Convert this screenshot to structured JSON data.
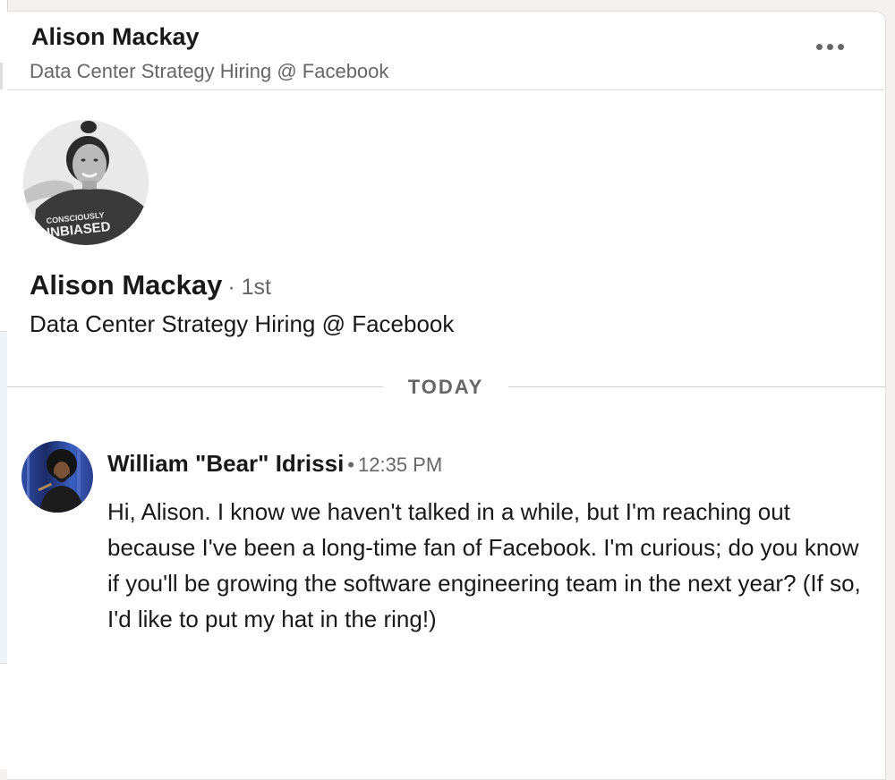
{
  "conversation": {
    "header": {
      "name": "Alison Mackay",
      "headline": "Data Center Strategy Hiring @ Facebook",
      "more_icon": "more-horizontal-icon"
    },
    "profile": {
      "name": "Alison Mackay",
      "degree": "· 1st",
      "headline": "Data Center Strategy Hiring @ Facebook",
      "shirt_text_1": "CONSCIOUSLY",
      "shirt_text_2": "UNBIASED"
    },
    "date_divider": "TODAY",
    "messages": [
      {
        "sender": "William \"Bear\" Idrissi",
        "separator": "•",
        "time": "12:35 PM",
        "body": "Hi, Alison. I know we haven't talked in a while, but I'm reaching out because I've been a long-time fan of Facebook. I'm curious; do you know if you'll be growing the software engineering team in the next year? (If so, I'd like to put my hat in the ring!)"
      }
    ]
  },
  "colors": {
    "text_primary": "#191919",
    "text_secondary": "#666666",
    "divider": "#cfcfcf",
    "background": "#f3f2ef"
  }
}
